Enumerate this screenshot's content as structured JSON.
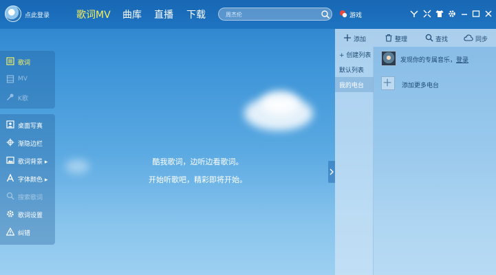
{
  "header": {
    "login": "点此登录",
    "tabs": [
      {
        "label": "歌词MV",
        "active": true
      },
      {
        "label": "曲库",
        "active": false
      },
      {
        "label": "直播",
        "active": false
      },
      {
        "label": "下载",
        "active": false
      }
    ],
    "search_placeholder": "周杰伦",
    "game_label": "游戏",
    "window_icons": [
      "skin-icon",
      "shrink-icon",
      "tshirt-icon",
      "gear-icon",
      "minimize-icon",
      "maximize-icon",
      "close-icon"
    ]
  },
  "left_menu": {
    "group1": [
      {
        "label": "歌词",
        "icon": "lyrics-icon",
        "state": "active"
      },
      {
        "label": "MV",
        "icon": "mv-icon",
        "state": "disabled"
      },
      {
        "label": "K歌",
        "icon": "mic-icon",
        "state": "disabled"
      }
    ],
    "group2": [
      {
        "label": "桌面写真",
        "icon": "photo-icon",
        "state": "normal"
      },
      {
        "label": "渐隐边栏",
        "icon": "move-icon",
        "state": "normal"
      },
      {
        "label": "歌词背景",
        "icon": "image-icon",
        "state": "normal",
        "arrow": "▸"
      },
      {
        "label": "字体颜色",
        "icon": "font-icon",
        "state": "normal",
        "arrow": "▸"
      },
      {
        "label": "搜索歌词",
        "icon": "search-icon",
        "state": "disabled"
      },
      {
        "label": "歌词设置",
        "icon": "gear-icon",
        "state": "normal"
      },
      {
        "label": "纠错",
        "icon": "warning-icon",
        "state": "normal"
      }
    ]
  },
  "center": {
    "line1": "酷我歌词，边听边看歌词。",
    "line2": "开始听歌吧，精彩即将开始。"
  },
  "right_panel": {
    "toolbar": [
      {
        "label": "添加",
        "icon": "plus-icon"
      },
      {
        "label": "整理",
        "icon": "trash-icon"
      },
      {
        "label": "查找",
        "icon": "search-icon"
      },
      {
        "label": "同步",
        "icon": "cloud-icon"
      }
    ],
    "side_list": [
      {
        "label": "+ 创建列表",
        "selected": false
      },
      {
        "label": "默认列表",
        "selected": false
      },
      {
        "label": "我的电台",
        "selected": true
      }
    ],
    "discover_text": "发现你的专属音乐，",
    "login_link": "登录",
    "add_radio": "添加更多电台"
  },
  "colors": {
    "active": "#f5f062",
    "panel_text": "#1f4a72"
  }
}
